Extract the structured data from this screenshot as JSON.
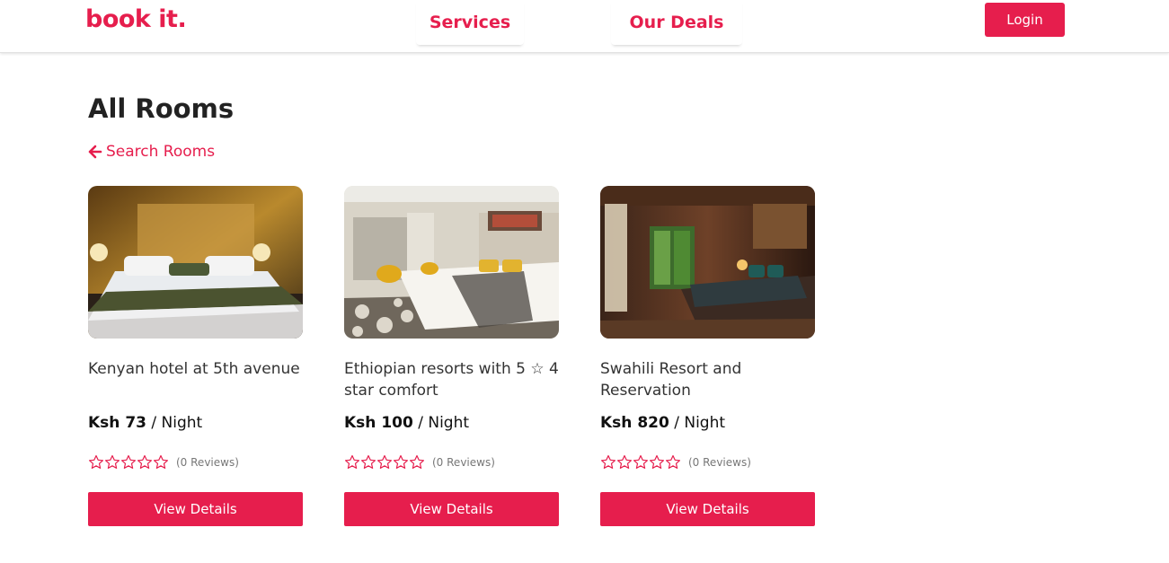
{
  "brand": "book it.",
  "nav": {
    "services": "Services",
    "deals": "Our Deals",
    "login": "Login"
  },
  "page": {
    "title": "All Rooms",
    "back_link": "Search Rooms"
  },
  "colors": {
    "accent": "#e61e4d"
  },
  "rooms": [
    {
      "title": "Kenyan hotel at 5th avenue",
      "price": "Ksh 73",
      "unit": " / Night",
      "reviews": "(0 Reviews)",
      "rating": 0,
      "button": "View Details"
    },
    {
      "title": "Ethiopian resorts with 5 ☆ 4 star comfort",
      "price": "Ksh 100",
      "unit": " / Night",
      "reviews": "(0 Reviews)",
      "rating": 0,
      "button": "View Details"
    },
    {
      "title": "Swahili Resort and Reservation",
      "price": "Ksh 820",
      "unit": " / Night",
      "reviews": "(0 Reviews)",
      "rating": 0,
      "button": "View Details"
    }
  ]
}
